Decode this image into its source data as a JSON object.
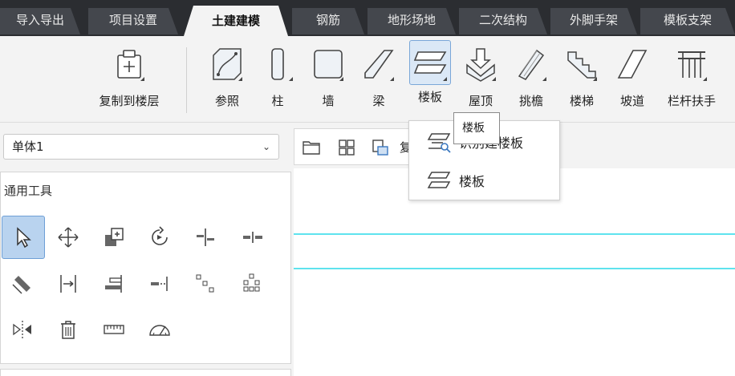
{
  "tabs": [
    {
      "label": "导入导出",
      "active": false
    },
    {
      "label": "项目设置",
      "active": false
    },
    {
      "label": "土建建模",
      "active": true
    },
    {
      "label": "钢筋",
      "active": false
    },
    {
      "label": "地形场地",
      "active": false
    },
    {
      "label": "二次结构",
      "active": false
    },
    {
      "label": "外脚手架",
      "active": false
    },
    {
      "label": "模板支架",
      "active": false
    }
  ],
  "ribbon": {
    "copy_to_floor": "复制到楼层",
    "reference": "参照",
    "column": "柱",
    "wall": "墙",
    "beam": "梁",
    "slab": "楼板",
    "roof": "屋顶",
    "eave": "挑檐",
    "stair": "楼梯",
    "ramp": "坡道",
    "railing": "栏杆扶手"
  },
  "unit_select": {
    "value": "单体1"
  },
  "panel": {
    "title": "通用工具"
  },
  "smallbar": {
    "truncated_text": "复"
  },
  "dropdown": {
    "items": [
      {
        "label": "识别建楼板"
      },
      {
        "label": "楼板"
      }
    ]
  },
  "tooltip": {
    "text": "楼板"
  },
  "colors": {
    "accent": "#5fe3ee",
    "tab_bg": "#2b2d31",
    "selected": "#b9d3ef"
  }
}
